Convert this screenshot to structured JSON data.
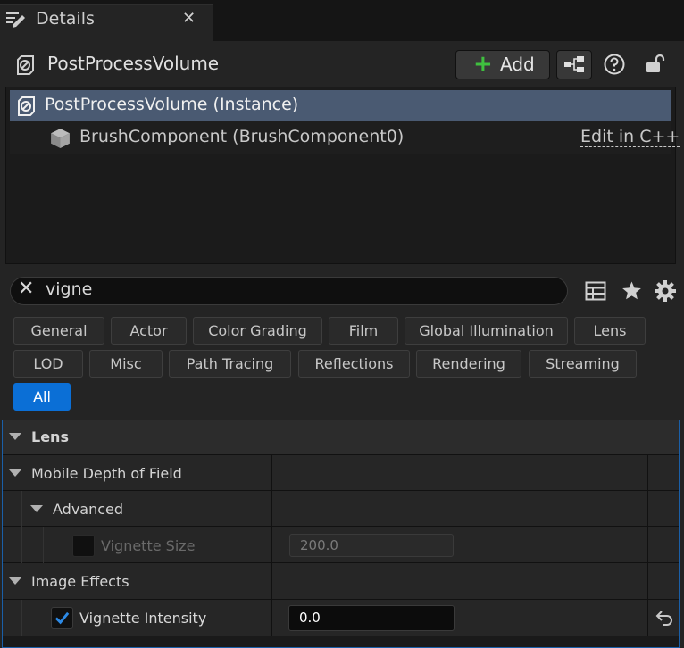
{
  "tab": {
    "title": "Details",
    "close": "✕"
  },
  "header": {
    "actor_name": "PostProcessVolume",
    "add_label": "Add"
  },
  "components": [
    {
      "label": "PostProcessVolume (Instance)",
      "selected": true
    },
    {
      "label": "BrushComponent (BrushComponent0)",
      "action": "Edit in C++"
    }
  ],
  "search": {
    "value": "vigne"
  },
  "filters": {
    "row1": [
      "General",
      "Actor",
      "Color Grading",
      "Film",
      "Global Illumination",
      "Lens"
    ],
    "row2": [
      "LOD",
      "Misc",
      "Path Tracing",
      "Reflections",
      "Rendering",
      "Streaming"
    ],
    "row3": [
      "All"
    ],
    "active": "All"
  },
  "properties": {
    "lens": "Lens",
    "mobile_dof": "Mobile Depth of Field",
    "advanced": "Advanced",
    "vignette_size": {
      "label": "Vignette Size",
      "value": "200.0",
      "checked": false,
      "enabled": false
    },
    "image_effects": "Image Effects",
    "vignette_intensity": {
      "label": "Vignette Intensity",
      "value": "0.0",
      "checked": true,
      "enabled": true
    }
  },
  "colors": {
    "accent": "#0b6fd6",
    "selection": "#4a5a72",
    "add_plus": "#3fbf3f"
  }
}
